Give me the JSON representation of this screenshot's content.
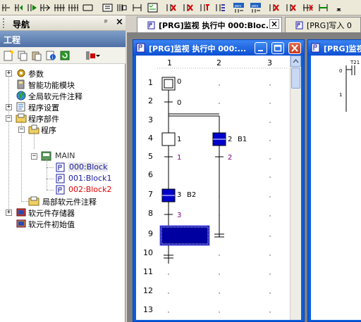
{
  "nav": {
    "title": "导航",
    "pin": "ᵖ",
    "close": "×",
    "project_label": "工程"
  },
  "tree": {
    "params": "参数",
    "smart_module": "智能功能模块",
    "global_label": "全局软元件注释",
    "program_settings": "程序设置",
    "program_parts": "程序部件",
    "program": "程序",
    "main": "MAIN",
    "block0": "000:Block",
    "block1": "001:Block1",
    "block2": "002:Block2",
    "local_label": "局部软元件注释",
    "device_memory": "软元件存储器",
    "device_init": "软元件初始值"
  },
  "tabs": [
    {
      "label": "[PRG]监视 执行中 000:Bloc...",
      "close": "×"
    },
    {
      "label": "[PRG]写入 0"
    }
  ],
  "win1": {
    "title": "[PRG]监视 执行中 000:..."
  },
  "win2": {
    "title": "[PRG]监视",
    "label_t": "T21",
    "row0": "0",
    "row1": "1"
  },
  "sfc": {
    "columns": [
      "1",
      "2",
      "3"
    ],
    "rows": [
      "1",
      "2",
      "3",
      "4",
      "5",
      "6",
      "7",
      "8",
      "9",
      "10",
      "11",
      "12",
      "13"
    ],
    "step0": "0",
    "trans0": "0",
    "step1": "1",
    "trans1": "1",
    "step2": "2",
    "step2_label": "B1",
    "trans2": "2",
    "step3": "3",
    "step3_label": "B2",
    "trans3": "3"
  },
  "colors": {
    "active_step": "#0000cc",
    "selected_block": "#0000a0",
    "tree_red": "#e00000",
    "tree_blue": "#1a1aa0"
  }
}
